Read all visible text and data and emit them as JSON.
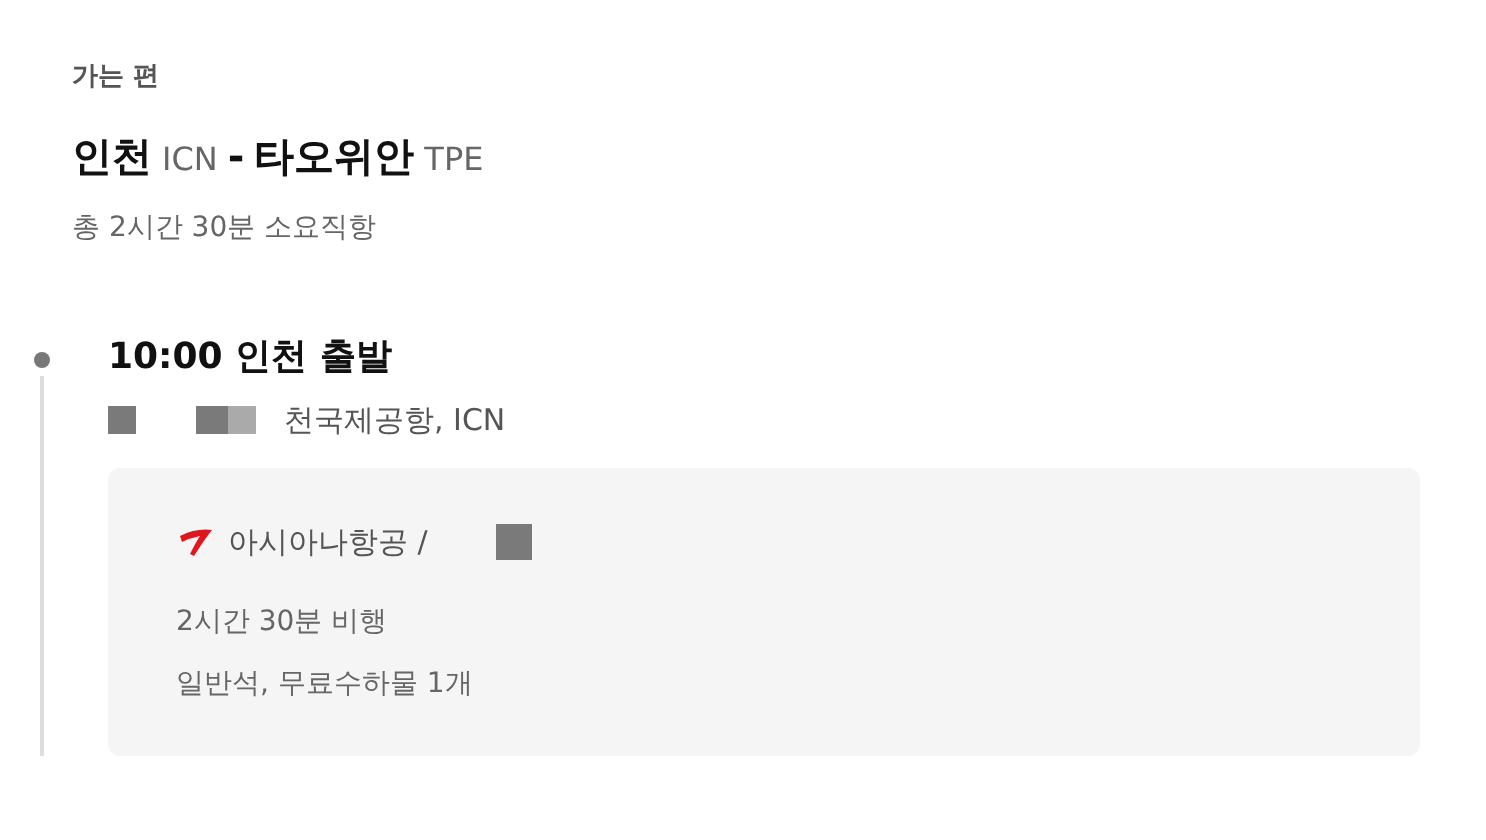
{
  "section_label": "가는 편",
  "route": {
    "origin_city": "인천",
    "origin_code": "ICN",
    "separator": "-",
    "destination_city": "타오위안",
    "destination_code": "TPE"
  },
  "summary": "총 2시간 30분 소요직항",
  "segment": {
    "departure": "10:00 인천 출발",
    "airport": "천국제공항, ICN",
    "card": {
      "airline": "아시아나항공 /",
      "duration": "2시간 30분 비행",
      "details": "일반석, 무료수하물 1개"
    }
  }
}
